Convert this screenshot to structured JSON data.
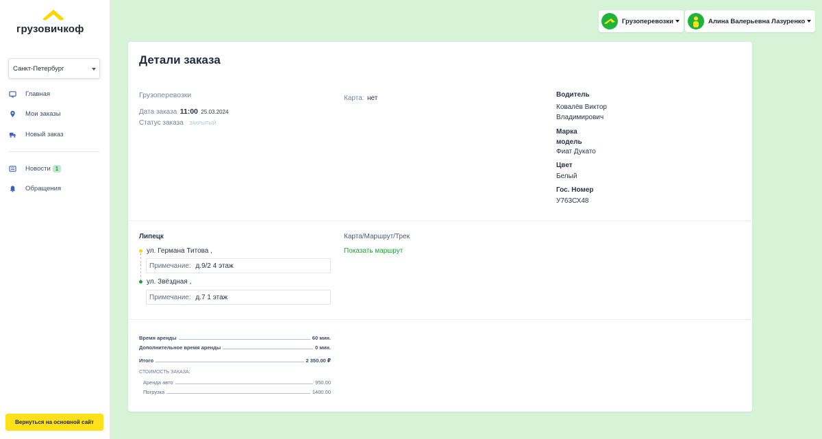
{
  "sidebar": {
    "logo_text": "грузовичкоф",
    "city": "Санкт-Петербург",
    "items": [
      {
        "label": "Главная",
        "icon": "monitor-icon"
      },
      {
        "label": "Мои заказы",
        "icon": "map-pin-icon"
      },
      {
        "label": "Новый заказ",
        "icon": "truck-icon"
      },
      {
        "label": "Новости",
        "icon": "newspaper-icon",
        "badge": "1"
      },
      {
        "label": "Обращения",
        "icon": "bell-icon"
      }
    ],
    "back_button": "Вернуться на основной сайт"
  },
  "topbar": {
    "service": "Грузоперевозки",
    "user": "Алина Валерьевна Лазуренко"
  },
  "order": {
    "title": "Детали заказа",
    "service": "Грузоперевозки",
    "date_label": "Дата заказа",
    "time": "11:00",
    "date": "25.03.2024",
    "status_label": "Статус заказа",
    "status": "закрытый",
    "card_label": "Карта:",
    "card_value": "нет",
    "driver_label": "Водитель",
    "driver_name": "Ковалёв Виктор Владимирович",
    "model_label": "Марка модель",
    "model": "Фиат Дукато",
    "color_label": "Цвет",
    "color": "Белый",
    "plate_label": "Гос. Номер",
    "plate": "У763СХ48"
  },
  "route": {
    "city": "Липецк",
    "map_label": "Карта/Маршрут/Трек",
    "show_route": "Показать маршрут",
    "note_label": "Примечание:",
    "points": [
      {
        "address": "ул. Германа Титова ,",
        "note": "д.9/2 4 этаж"
      },
      {
        "address": "ул. Звёздная ,",
        "note": "д.7 1 этаж"
      }
    ]
  },
  "costs": {
    "rent_time_label": "Время аренды",
    "rent_time": "60 мин.",
    "extra_time_label": "Дополнительное время аренды",
    "extra_time": "0 мин.",
    "total_label": "Итого",
    "total": "2 350.00 ₽",
    "breakdown_title": "Стоимость заказа:",
    "items": [
      {
        "label": "Аренда авто",
        "value": "950.00"
      },
      {
        "label": "Погрузка",
        "value": "1400.00"
      }
    ]
  },
  "colors": {
    "background": "#d6f3d8",
    "accent_yellow": "#ffe11b",
    "link_green": "#19a23a"
  }
}
